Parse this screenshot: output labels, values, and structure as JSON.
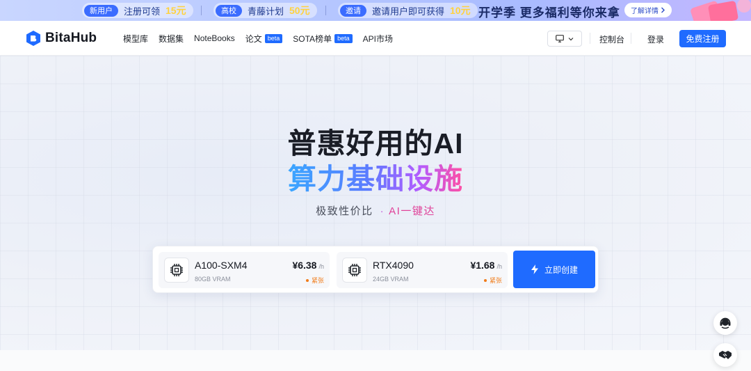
{
  "promo": {
    "items": [
      {
        "tag": "新用户",
        "text": "注册可领",
        "amount": "15元"
      },
      {
        "tag": "高校",
        "text": "青藤计划",
        "amount": "50元"
      },
      {
        "tag": "邀请",
        "text": "邀请用户即可获得",
        "amount": "10元"
      }
    ],
    "headline": "开学季 更多福利等你来拿",
    "cta": "了解详情"
  },
  "nav": {
    "logo": "BitaHub",
    "menu": [
      {
        "label": "模型库"
      },
      {
        "label": "数据集"
      },
      {
        "label": "NoteBooks"
      },
      {
        "label": "论文",
        "badge": "beta"
      },
      {
        "label": "SOTA榜单",
        "badge": "beta"
      },
      {
        "label": "API市场"
      }
    ],
    "console": "控制台",
    "login": "登录",
    "signup": "免费注册"
  },
  "hero": {
    "title_line1": "普惠好用的AI",
    "title_line2": "算力基础设施",
    "subtitle": "极致性价比",
    "subtitle_dot": "·",
    "subtitle_accent": "AI一键达"
  },
  "gpus": [
    {
      "name": "A100-SXM4",
      "vram": "80GB VRAM",
      "price": "¥6.38",
      "unit": "/h",
      "status": "紧张"
    },
    {
      "name": "RTX4090",
      "vram": "24GB VRAM",
      "price": "¥1.68",
      "unit": "/h",
      "status": "紧张"
    }
  ],
  "create_button": "立即创建",
  "colors": {
    "brand": "#1f6bff",
    "status_warn": "#f07c1a"
  }
}
